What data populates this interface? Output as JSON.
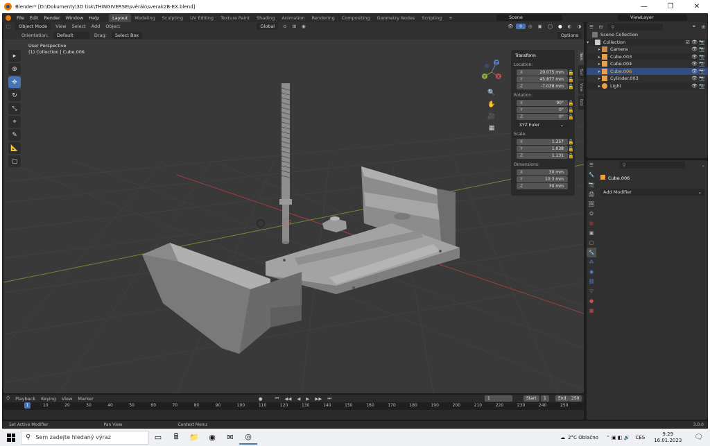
{
  "window": {
    "title": "Blender* [D:\\Dokumenty\\3D tisk\\THINGIVERSE\\svěrák\\sverak2B-EX.blend]"
  },
  "menu": [
    "File",
    "Edit",
    "Render",
    "Window",
    "Help"
  ],
  "workspaces": [
    "Layout",
    "Modeling",
    "Sculpting",
    "UV Editing",
    "Texture Paint",
    "Shading",
    "Animation",
    "Rendering",
    "Compositing",
    "Geometry Nodes",
    "Scripting",
    "+"
  ],
  "active_workspace": "Layout",
  "scene": "Scene",
  "view_layer": "ViewLayer",
  "viewport": {
    "mode": "Object Mode",
    "header_menu": [
      "View",
      "Select",
      "Add",
      "Object"
    ],
    "transform_orientation": "Global",
    "orientation_label": "Orientation:",
    "orientation_value": "Default",
    "drag_label": "Drag:",
    "drag_value": "Select Box",
    "options_label": "Options",
    "info_line1": "User Perspective",
    "info_line2": "(1) Collection | Cube.006"
  },
  "npanel": {
    "section": "Transform",
    "location_label": "Location:",
    "location": {
      "x": "20.075 mm",
      "y": "45.877 mm",
      "z": "-7.038 mm"
    },
    "rotation_label": "Rotation:",
    "rotation": {
      "x": "90°",
      "y": "0°",
      "z": "0°"
    },
    "rotation_mode": "XYZ Euler",
    "scale_label": "Scale:",
    "scale": {
      "x": "1.357",
      "y": "1.038",
      "z": "1.131"
    },
    "dimensions_label": "Dimensions:",
    "dimensions": {
      "x": "30 mm",
      "y": "10.3 mm",
      "z": "30 mm"
    },
    "tabs": [
      "Item",
      "Tool",
      "View",
      "Edit"
    ]
  },
  "axis_labels": {
    "x": "X",
    "y": "Y",
    "z": "Z"
  },
  "timeline": {
    "menu": [
      "Playback",
      "Keying",
      "View",
      "Marker"
    ],
    "current_frame": "1",
    "start_label": "Start",
    "start": "1",
    "end_label": "End",
    "end": "250",
    "ticks": [
      "1",
      "10",
      "20",
      "30",
      "40",
      "50",
      "60",
      "70",
      "80",
      "90",
      "100",
      "110",
      "120",
      "130",
      "140",
      "150",
      "160",
      "170",
      "180",
      "190",
      "200",
      "210",
      "220",
      "230",
      "240",
      "250"
    ]
  },
  "statusbar": {
    "hints": [
      "Set Active Modifier",
      "Pan View",
      "Context Menu"
    ],
    "version": "3.0.0"
  },
  "outliner": {
    "root": "Scene Collection",
    "collection": "Collection",
    "items": [
      {
        "name": "Camera",
        "color": "#c8884e"
      },
      {
        "name": "Cube.003",
        "color": "#e8a04c"
      },
      {
        "name": "Cube.004",
        "color": "#e8a04c"
      },
      {
        "name": "Cube.006",
        "color": "#e8a04c"
      },
      {
        "name": "Cylinder.003",
        "color": "#e8a04c"
      },
      {
        "name": "Light",
        "color": "#e8a04c"
      }
    ]
  },
  "properties": {
    "object_name": "Cube.006",
    "add_modifier": "Add Modifier"
  },
  "taskbar": {
    "search_placeholder": "Sem zadejte hledaný výraz",
    "weather": "2°C  Oblačno",
    "lang": "CES",
    "time": "9:29",
    "date": "16.01.2023"
  },
  "colors": {
    "accent": "#4772b3",
    "orange": "#e87d0d",
    "viewport_bg": "#393939"
  }
}
